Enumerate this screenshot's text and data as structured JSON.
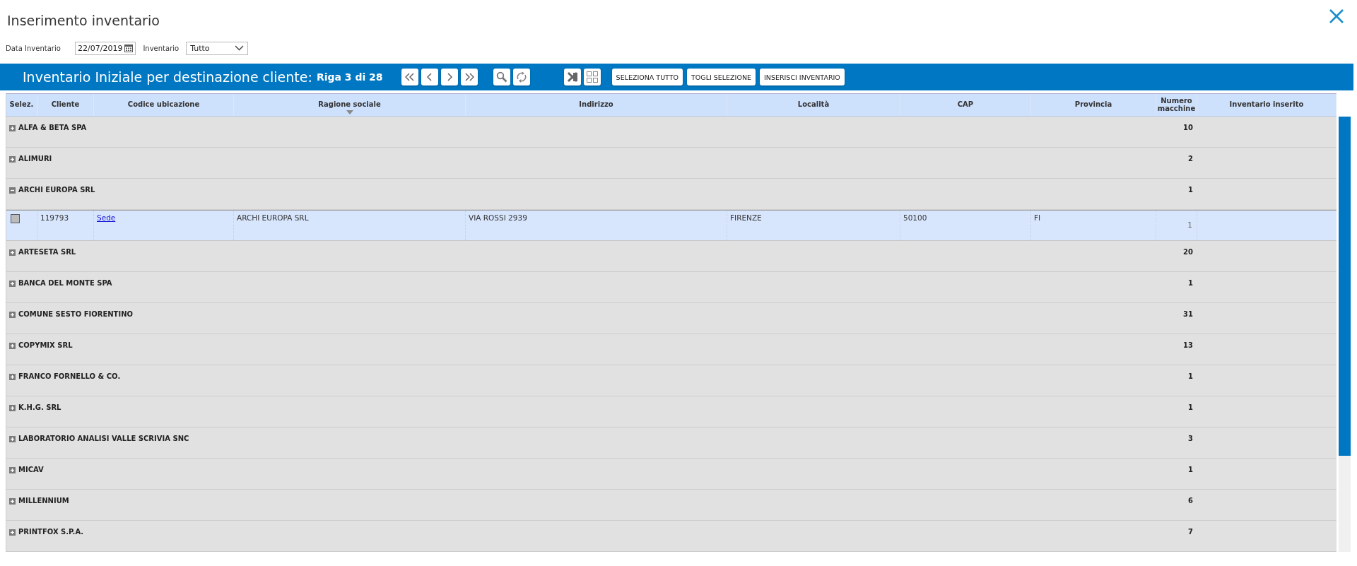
{
  "window": {
    "title": "Inserimento inventario"
  },
  "filters": {
    "date_label": "Data Inventario",
    "date_value": "22/07/2019",
    "inventory_label": "Inventario",
    "inventory_value": "Tutto"
  },
  "toolbar": {
    "title": "Inventario Iniziale per destinazione cliente:",
    "position": "Riga 3 di 28",
    "buttons": [
      "SELEZIONA TUTTO",
      "TOGLI SELEZIONE",
      "INSERISCI INVENTARIO"
    ]
  },
  "table": {
    "columns": [
      {
        "label": "Selez.",
        "sorted": false
      },
      {
        "label": "Cliente",
        "sorted": false
      },
      {
        "label": "Codice ubicazione",
        "sorted": false
      },
      {
        "label": "Ragione sociale",
        "sorted": true
      },
      {
        "label": "Indirizzo",
        "sorted": false
      },
      {
        "label": "Località",
        "sorted": false
      },
      {
        "label": "CAP",
        "sorted": false
      },
      {
        "label": "Provincia",
        "sorted": false
      },
      {
        "label": "Numero macchine",
        "sorted": false
      },
      {
        "label": "Inventario inserito",
        "sorted": false
      }
    ],
    "rows": [
      {
        "kind": "group",
        "name": "ALFA & BETA SPA",
        "count": "10",
        "expanded": false
      },
      {
        "kind": "group",
        "name": "ALIMURI",
        "count": "2",
        "expanded": false
      },
      {
        "kind": "group",
        "name": "ARCHI EUROPA SRL",
        "count": "1",
        "expanded": true
      },
      {
        "kind": "detail",
        "checked": false,
        "client": "119793",
        "location_code": "Sede",
        "company_name": "ARCHI EUROPA SRL",
        "address": "VIA ROSSI 2939",
        "city": "FIRENZE",
        "postal_code": "50100",
        "province": "FI",
        "machines": "1"
      },
      {
        "kind": "group",
        "name": "ARTESETA SRL",
        "count": "20",
        "expanded": false
      },
      {
        "kind": "group",
        "name": "BANCA DEL MONTE SPA",
        "count": "1",
        "expanded": false
      },
      {
        "kind": "group",
        "name": "COMUNE SESTO FIORENTINO",
        "count": "31",
        "expanded": false
      },
      {
        "kind": "group",
        "name": "COPYMIX SRL",
        "count": "13",
        "expanded": false
      },
      {
        "kind": "group",
        "name": "FRANCO FORNELLO & CO.",
        "count": "1",
        "expanded": false
      },
      {
        "kind": "group",
        "name": "K.H.G. SRL",
        "count": "1",
        "expanded": false
      },
      {
        "kind": "group",
        "name": "LABORATORIO ANALISI VALLE SCRIVIA SNC",
        "count": "3",
        "expanded": false
      },
      {
        "kind": "group",
        "name": "MICAV",
        "count": "1",
        "expanded": false
      },
      {
        "kind": "group",
        "name": "MILLENNIUM",
        "count": "6",
        "expanded": false
      },
      {
        "kind": "group",
        "name": "PRINTFOX S.P.A.",
        "count": "7",
        "expanded": false
      }
    ]
  }
}
